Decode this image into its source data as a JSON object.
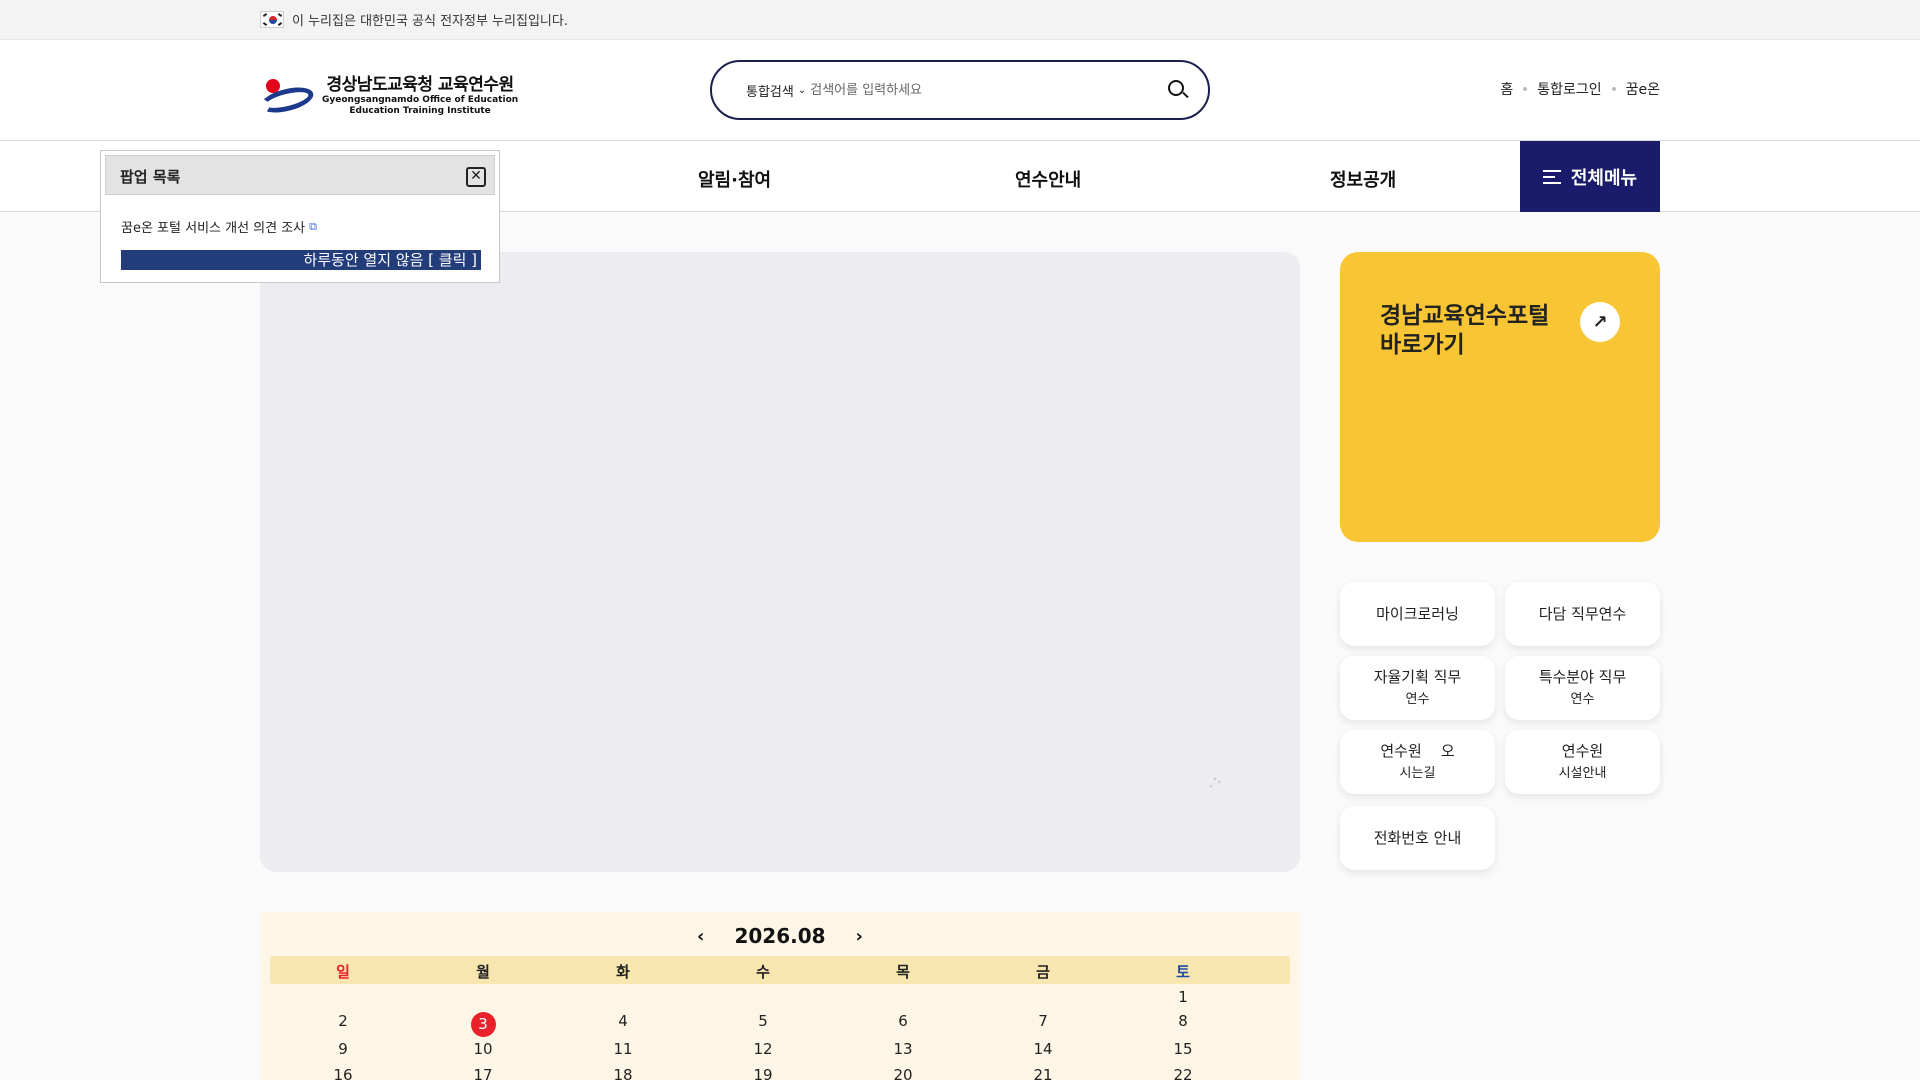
{
  "gov_banner": {
    "text": "이 누리집은 대한민국 공식 전자정부 누리집입니다."
  },
  "logo": {
    "name_ko": "경상남도교육청 교육연수원",
    "name_en_1": "Gyeongsangnamdo Office of Education",
    "name_en_2": "Education Training Institute"
  },
  "search": {
    "scope": "통합검색",
    "placeholder": "검색어를 입력하세요"
  },
  "util_links": [
    "홈",
    "통합로그인",
    "꿈e온"
  ],
  "gnb": {
    "items": [
      "알림·참여",
      "연수안내",
      "정보공개"
    ],
    "all_menu": "전체메뉴"
  },
  "popup": {
    "title": "팝업 목록",
    "close": "✕",
    "link": "꿈e온 포털 서비스 개선 의견 조사",
    "not_today": "하루동안 열지 않음 [ 클릭 ]"
  },
  "portal_card": {
    "title": "경남교육연수포털\n바로가기",
    "arrow": "↗"
  },
  "quick_menu": [
    {
      "line1": "마이크로러닝",
      "line2": ""
    },
    {
      "line1": "다담 직무연수",
      "line2": ""
    },
    {
      "line1": "자율기획 직무",
      "line2": "연수"
    },
    {
      "line1": "특수분야 직무",
      "line2": "연수"
    },
    {
      "line1": "연수원    오",
      "line2": "시는길"
    },
    {
      "line1": "연수원",
      "line2": "시설안내"
    },
    {
      "line1": "전화번호 안내",
      "line2": ""
    }
  ],
  "calendar": {
    "month": "2026.08",
    "prev": "‹",
    "next": "›",
    "weekdays": [
      "일",
      "월",
      "화",
      "수",
      "목",
      "금",
      "토"
    ],
    "weekday_colors": {
      "sun": "#e8212a",
      "sat": "#1d4aa0"
    },
    "today": "3",
    "weeks": [
      [
        "",
        "",
        "",
        "",
        "",
        "",
        "1"
      ],
      [
        "2",
        "3",
        "4",
        "5",
        "6",
        "7",
        "8"
      ],
      [
        "9",
        "10",
        "11",
        "12",
        "13",
        "14",
        "15"
      ],
      [
        "16",
        "17",
        "18",
        "19",
        "20",
        "21",
        "22"
      ]
    ]
  }
}
